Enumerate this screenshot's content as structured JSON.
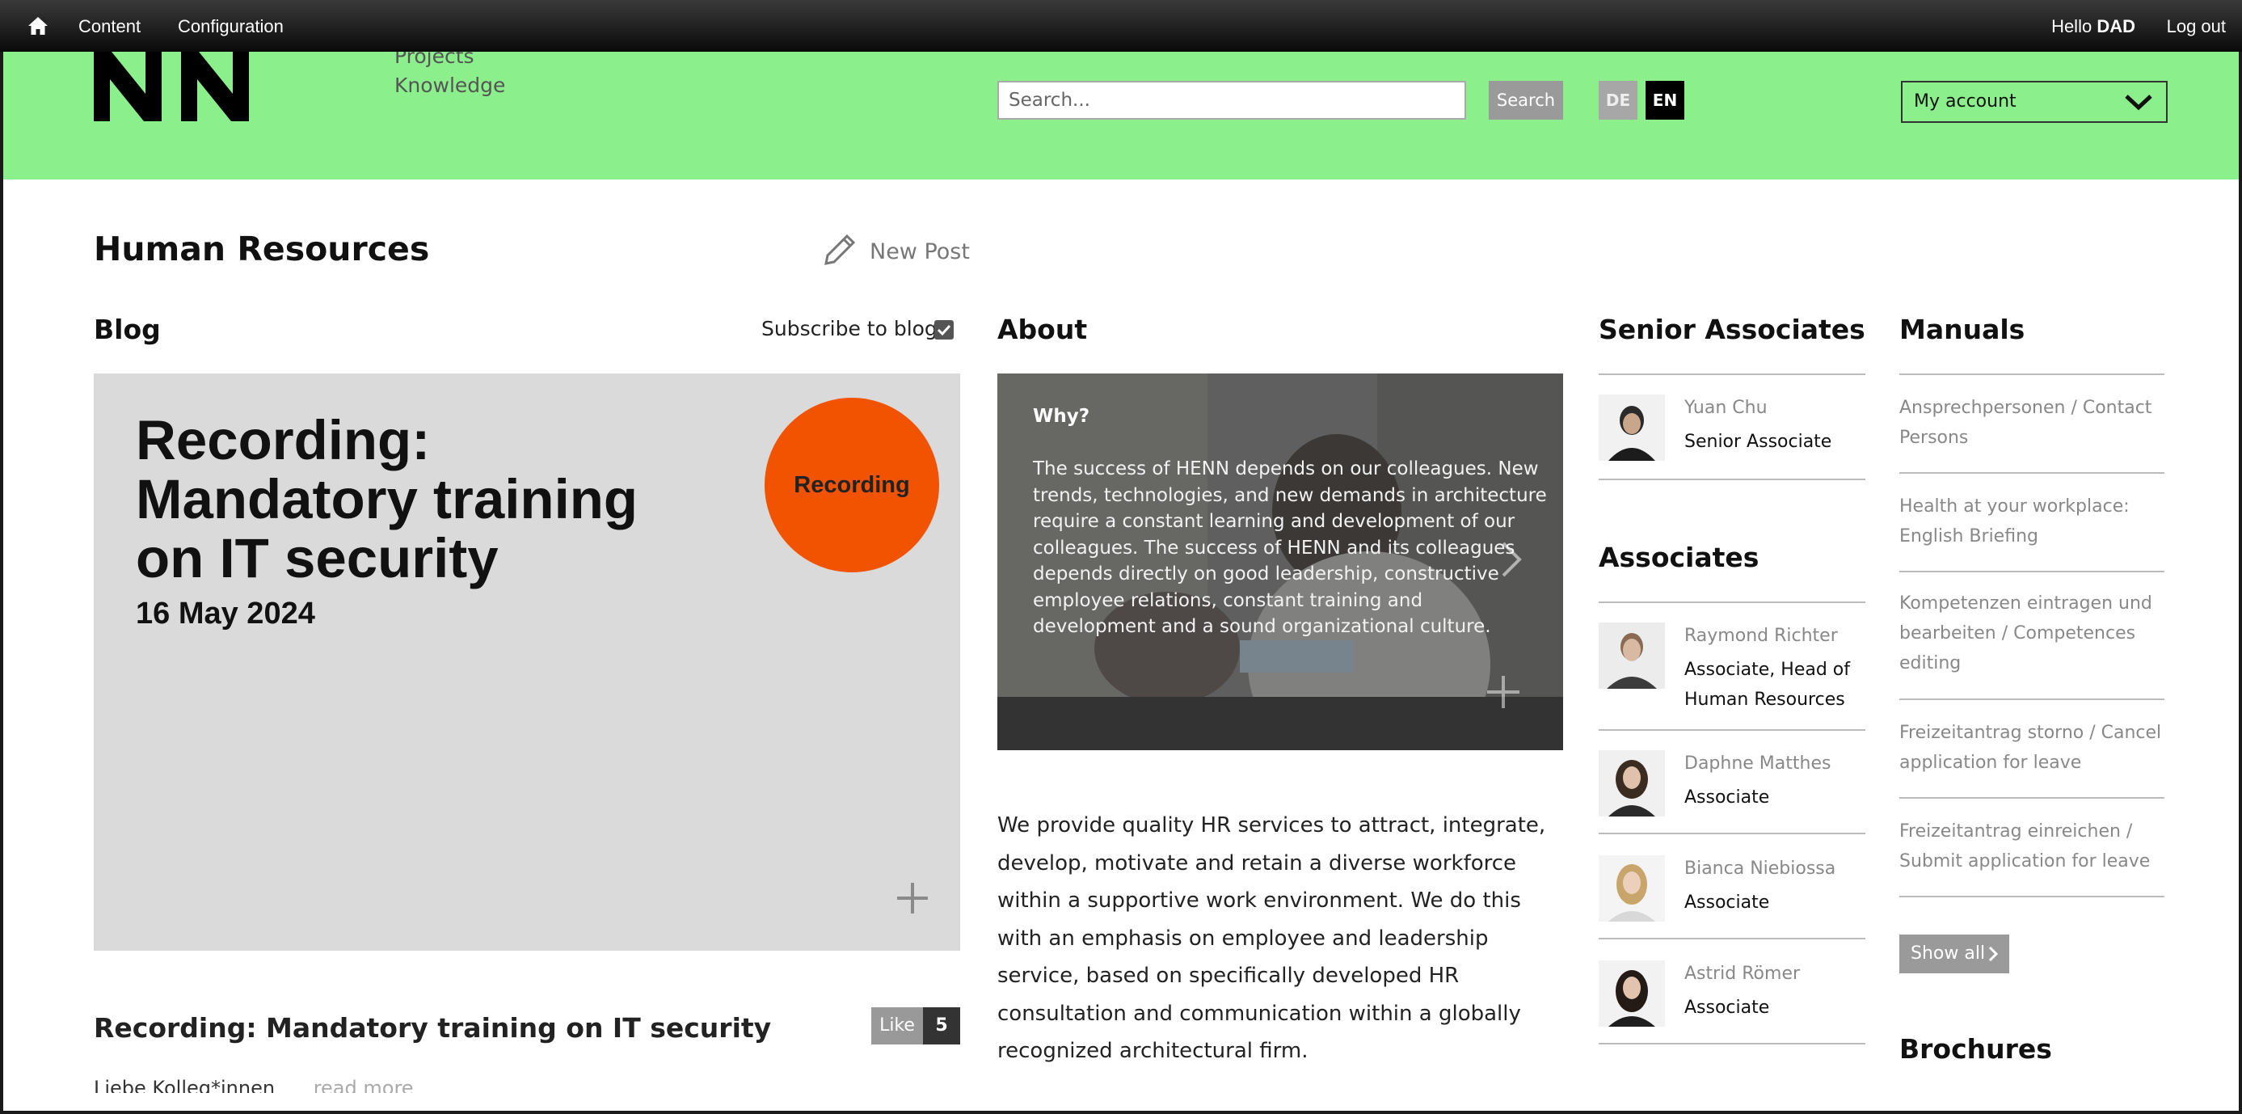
{
  "adminbar": {
    "content_label": "Content",
    "configuration_label": "Configuration",
    "hello_prefix": "Hello",
    "user_name": "DAD",
    "logout_label": "Log out"
  },
  "header": {
    "logo_text": "NN",
    "nav": [
      "Projects",
      "Knowledge"
    ],
    "search_placeholder": "Search...",
    "search_button": "Search",
    "lang_de": "DE",
    "lang_en": "EN",
    "account_label": "My account"
  },
  "page": {
    "title": "Human Resources",
    "new_post_label": "New Post"
  },
  "blog": {
    "heading": "Blog",
    "subscribe_label": "Subscribe to blog",
    "subscribed": true,
    "card_headline": "Recording: Mandatory training on IT security",
    "card_date": "16 May 2024",
    "card_badge": "Recording",
    "post_title": "Recording: Mandatory training on IT security",
    "like_label": "Like",
    "like_count": "5",
    "teaser_text": "Liebe Kolleg*innen",
    "read_more": "read more"
  },
  "about": {
    "heading": "About",
    "image_heading": "Why?",
    "image_text": "The success of HENN depends on our colleagues. New trends, technologies, and new demands in architecture require a constant learning and development of our colleagues. The success of HENN and its colleagues depends directly on good leadership, constructive employee relations, constant training and development and a sound organizational culture.",
    "body": "We provide quality HR services to attract, integrate, develop, motivate and retain a diverse workforce within a supportive work environment. We do this with an emphasis on employee and leadership service, based on specifically developed HR consultation and communication within a globally recognized architectural firm."
  },
  "senior_associates": {
    "heading": "Senior Associates",
    "people": [
      {
        "name": "Yuan Chu",
        "role": "Senior Associate"
      }
    ]
  },
  "associates": {
    "heading": "Associates",
    "people": [
      {
        "name": "Raymond Richter",
        "role": "Associate, Head of Human Resources"
      },
      {
        "name": "Daphne Matthes",
        "role": "Associate"
      },
      {
        "name": "Bianca Niebiossa",
        "role": "Associate"
      },
      {
        "name": "Astrid Römer",
        "role": "Associate"
      }
    ]
  },
  "manuals": {
    "heading": "Manuals",
    "items": [
      "Ansprechpersonen / Contact Persons",
      "Health at your workplace: English Briefing",
      "Kompetenzen eintragen und bearbeiten / Competences editing",
      "Freizeitantrag storno / Cancel application for leave",
      "Freizeitantrag einreichen / Submit application for leave"
    ],
    "show_all_label": "Show all"
  },
  "brochures": {
    "heading": "Brochures"
  },
  "colors": {
    "header_green": "#8bef8b",
    "badge_orange": "#f15300",
    "card_grey": "#dadada"
  }
}
